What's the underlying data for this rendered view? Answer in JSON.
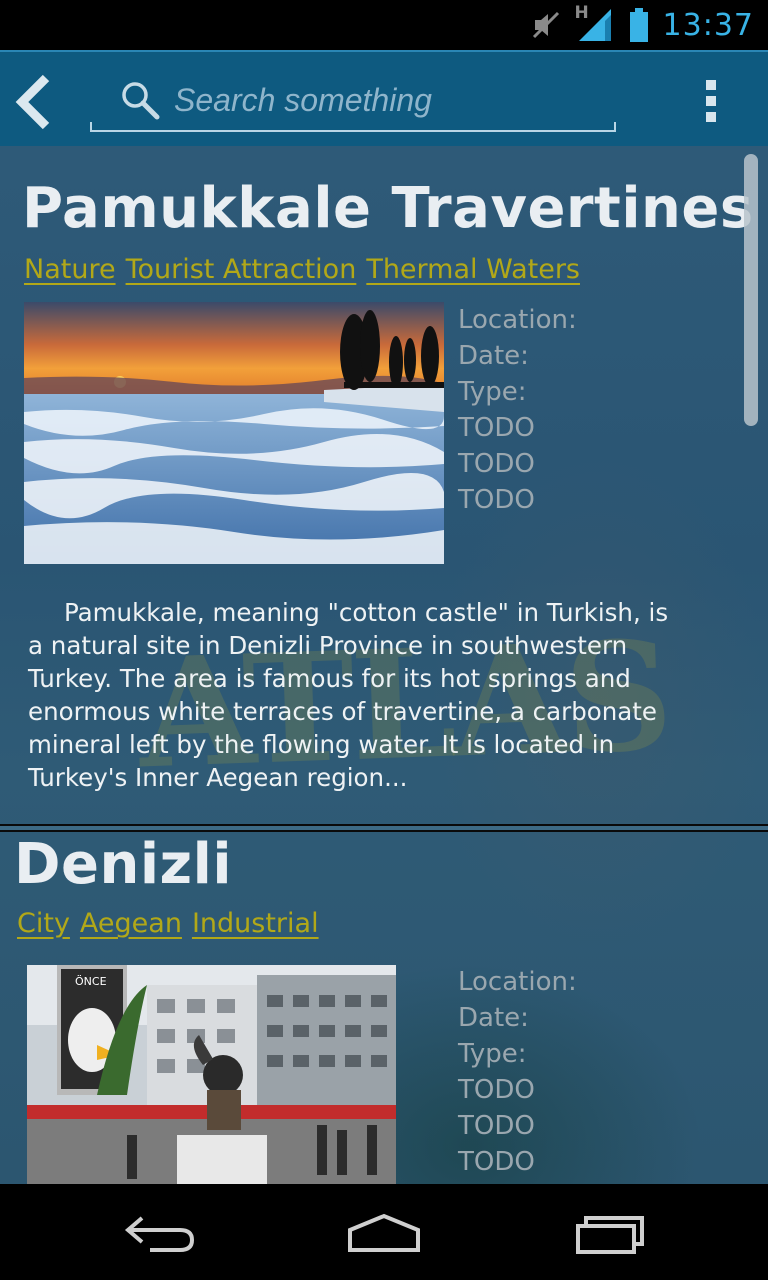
{
  "status_bar": {
    "time": "13:37",
    "network_label": "H",
    "icons": [
      "mute-icon",
      "signal-icon",
      "battery-icon"
    ]
  },
  "action_bar": {
    "back_icon": "chevron-left-icon",
    "search_placeholder": "Search something",
    "search_value": "",
    "menu_icon": "overflow-menu-icon"
  },
  "places": [
    {
      "title": "Pamukkale Travertines",
      "tags": [
        "Nature",
        "Tourist Attraction",
        "Thermal Waters"
      ],
      "info_labels": [
        "Location:",
        "Date:",
        "Type:"
      ],
      "info_values": [
        "TODO",
        "TODO",
        "TODO"
      ],
      "description": "Pamukkale, meaning \"cotton castle\" in Turkish, is a natural site in Denizli Province in southwestern Turkey. The area is famous for its hot springs and enormous white terraces of travertine, a carbonate mineral left by the flowing water. It is located in Turkey's Inner Aegean region..."
    },
    {
      "title": "Denizli",
      "tags": [
        "City",
        "Aegean",
        "Industrial"
      ],
      "info_labels": [
        "Location:",
        "Date:",
        "Type:"
      ],
      "info_values": [
        "TODO",
        "TODO",
        "TODO"
      ],
      "photo_sign": "ÖNCE"
    }
  ],
  "colors": {
    "action_bar": "#0e5a80",
    "tag_text": "#b2a818",
    "title_text": "#e9eef2",
    "status_accent": "#39b3e6"
  },
  "nav_bar": {
    "icons": [
      "back-nav-icon",
      "home-nav-icon",
      "recent-apps-icon"
    ]
  }
}
